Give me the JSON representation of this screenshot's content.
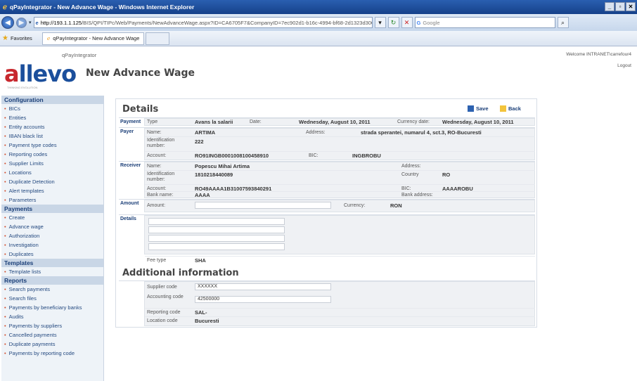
{
  "browser": {
    "title": "qPayIntegrator - New Advance Wage - Windows Internet Explorer",
    "url_host": "http://193.1.1.125",
    "url_path": "/BIS/QPI/TIPc/Web/Payments/NewAdvanceWage.aspx?ID=CA6705F7&CompanyID=7ec902d1-b16c-4994-bf68-2d1323d300eb",
    "search_placeholder": "Google",
    "favorites_label": "Favorites",
    "tab_label": "qPayIntegrator - New Advance Wage"
  },
  "header": {
    "app_name": "qPayIntegrator",
    "logo_a": "a",
    "logo_rest": "llevo",
    "logo_tagline": "THINKING EVOLUTION",
    "page_title": "New Advance Wage",
    "welcome": "Welcome  INTRANET\\carrefour4",
    "logout": "Logout"
  },
  "sidebar": {
    "sections": [
      {
        "title": "Configuration",
        "items": [
          "BICs",
          "Entities",
          "Entity accounts",
          "IBAN black list",
          "Payment type codes",
          "Reporting codes",
          "Supplier Limits",
          "Locations",
          "Duplicate Detection",
          "Alert templates",
          "Parameters"
        ]
      },
      {
        "title": "Payments",
        "items": [
          "Create",
          "Advance wage",
          "Authorization",
          "Investigation",
          "Duplicates"
        ]
      },
      {
        "title": "Templates",
        "items": [
          "Template lists"
        ]
      },
      {
        "title": "Reports",
        "items": [
          "Search payments",
          "Search files",
          "Payments by beneficiary banks",
          "Audits",
          "Payments by suppliers",
          "Cancelled payments",
          "Duplicate payments",
          "Payments by reporting code"
        ]
      }
    ]
  },
  "details": {
    "title": "Details",
    "save": "Save",
    "back": "Back",
    "payment": {
      "section": "Payment",
      "type_label": "Type",
      "type_value": "Avans la salarii",
      "date_label": "Date:",
      "date_value": "Wednesday, August 10, 2011",
      "currency_date_label": "Currency date:",
      "currency_date_value": "Wednesday, August 10, 2011"
    },
    "payer": {
      "section": "Payer",
      "name_label": "Name:",
      "name_value": "ARTIMA",
      "address_label": "Address:",
      "address_value": "strada sperantei, numarul 4, sct.3, RO-Bucuresti",
      "id_label": "Identification number:",
      "id_value": "222",
      "account_label": "Account:",
      "account_value": "RO91INGB0001008100458910",
      "bic_label": "BIC:",
      "bic_value": "INGBROBU"
    },
    "receiver": {
      "section": "Receiver",
      "name_label": "Name:",
      "name_value": "Popescu Mihai Artima",
      "address_label": "Address:",
      "address_value": "",
      "id_label": "Identification number:",
      "id_value": "1810218440089",
      "country_label": "Country",
      "country_value": "RO",
      "account_label": "Account:",
      "account_value": "RO49AAAA1B31007593840291",
      "bic_label": "BIC:",
      "bic_value": "AAAAROBU",
      "bank_name_label": "Bank name:",
      "bank_name_value": "AAAA",
      "bank_address_label": "Bank address:",
      "bank_address_value": ""
    },
    "amount": {
      "section": "Amount",
      "amount_label": "Amount:",
      "amount_value": "",
      "currency_label": "Currency:",
      "currency_value": "RON"
    },
    "details_section": {
      "section": "Details",
      "lines": [
        "",
        "",
        "",
        ""
      ],
      "fee_type_label": "Fee type",
      "fee_type_value": "SHA"
    }
  },
  "additional": {
    "title": "Additional information",
    "supplier_code_label": "Supplier code",
    "supplier_code_value": "XXXXXX",
    "accounting_code_label": "Accounting code",
    "accounting_code_value": "42500000",
    "reporting_code_label": "Reporting code",
    "reporting_code_value": "SAL-",
    "location_code_label": "Location code",
    "location_code_value": "Bucuresti"
  }
}
